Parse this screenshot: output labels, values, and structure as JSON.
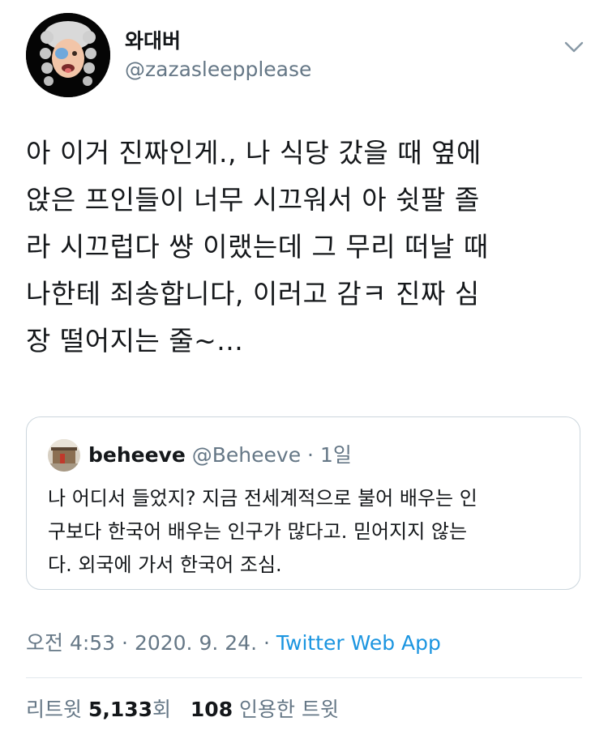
{
  "author": {
    "display_name": "와대버",
    "handle": "@zazasleepplease"
  },
  "tweet": {
    "text": "아 이거 진짜인게., 나 식당 갔을 때 옆에\n앉은 프인들이 너무 시끄워서 아 쉿팔 졸\n라 시끄럽다 썅 이랬는데 그 무리 떠날 때\n나한테 죄송합니다, 이러고 감ㅋ 진짜 심\n장 떨어지는 줄~..."
  },
  "quoted_tweet": {
    "display_name": "beheeve",
    "handle": "@Beheeve",
    "separator": " · ",
    "time": "1일",
    "text": "나 어디서 들었지? 지금 전세계적으로 불어 배우는 인\n구보다 한국어 배우는 인구가 많다고. 믿어지지 않는\n다. 외국에 가서 한국어 조심."
  },
  "meta": {
    "time": "오전 4:53",
    "separator1": " · ",
    "date": "2020. 9. 24.",
    "separator2": " · ",
    "source": "Twitter Web App"
  },
  "stats": {
    "retweet_label": "리트윗",
    "retweet_count": "5,133",
    "retweet_suffix": "회",
    "quote_count": "108",
    "quote_label": "인용한 트윗"
  },
  "icons": {
    "menu": "chevron-down-icon",
    "avatar": "avatar",
    "quoted_avatar": "avatar"
  },
  "colors": {
    "text": "#14171a",
    "secondary": "#657786",
    "link": "#1b95e0",
    "border": "#ccd6dd"
  }
}
